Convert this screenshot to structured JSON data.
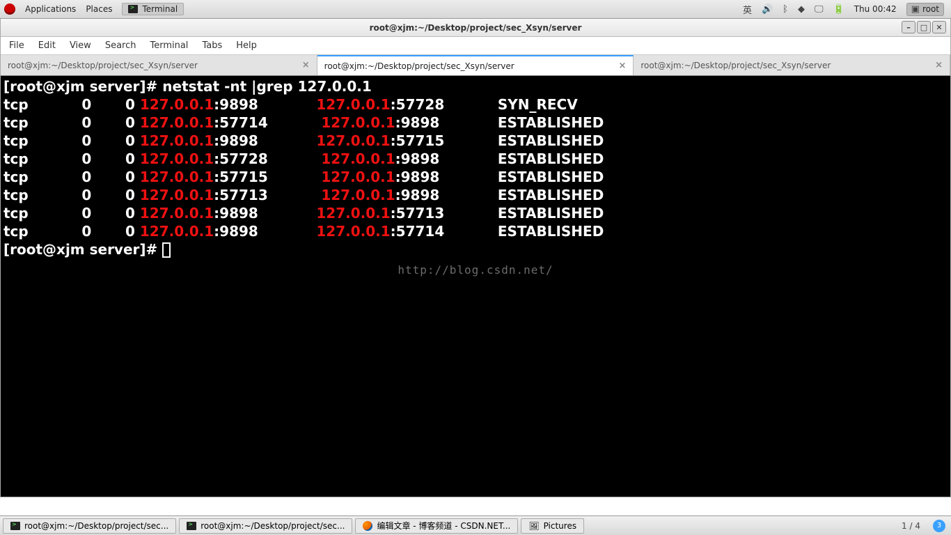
{
  "top_panel": {
    "applications": "Applications",
    "places": "Places",
    "running_app": "Terminal",
    "ime": "英",
    "clock": "Thu 00:42",
    "user": "root"
  },
  "window": {
    "title": "root@xjm:~/Desktop/project/sec_Xsyn/server",
    "menus": [
      "File",
      "Edit",
      "View",
      "Search",
      "Terminal",
      "Tabs",
      "Help"
    ],
    "tabs": [
      {
        "label": "root@xjm:~/Desktop/project/sec_Xsyn/server"
      },
      {
        "label": "root@xjm:~/Desktop/project/sec_Xsyn/server"
      },
      {
        "label": "root@xjm:~/Desktop/project/sec_Xsyn/server"
      }
    ]
  },
  "terminal": {
    "prompt": "[root@xjm server]# ",
    "command": "netstat -nt |grep 127.0.0.1",
    "rows": [
      {
        "proto": "tcp",
        "rq": "0",
        "sq": "0",
        "la_ip": "127.0.0.1",
        "la_port": "9898",
        "fa_ip": "127.0.0.1",
        "fa_port": "57728",
        "state": "SYN_RECV"
      },
      {
        "proto": "tcp",
        "rq": "0",
        "sq": "0",
        "la_ip": "127.0.0.1",
        "la_port": "57714",
        "fa_ip": "127.0.0.1",
        "fa_port": "9898",
        "state": "ESTABLISHED"
      },
      {
        "proto": "tcp",
        "rq": "0",
        "sq": "0",
        "la_ip": "127.0.0.1",
        "la_port": "9898",
        "fa_ip": "127.0.0.1",
        "fa_port": "57715",
        "state": "ESTABLISHED"
      },
      {
        "proto": "tcp",
        "rq": "0",
        "sq": "0",
        "la_ip": "127.0.0.1",
        "la_port": "57728",
        "fa_ip": "127.0.0.1",
        "fa_port": "9898",
        "state": "ESTABLISHED"
      },
      {
        "proto": "tcp",
        "rq": "0",
        "sq": "0",
        "la_ip": "127.0.0.1",
        "la_port": "57715",
        "fa_ip": "127.0.0.1",
        "fa_port": "9898",
        "state": "ESTABLISHED"
      },
      {
        "proto": "tcp",
        "rq": "0",
        "sq": "0",
        "la_ip": "127.0.0.1",
        "la_port": "57713",
        "fa_ip": "127.0.0.1",
        "fa_port": "9898",
        "state": "ESTABLISHED"
      },
      {
        "proto": "tcp",
        "rq": "0",
        "sq": "0",
        "la_ip": "127.0.0.1",
        "la_port": "9898",
        "fa_ip": "127.0.0.1",
        "fa_port": "57713",
        "state": "ESTABLISHED"
      },
      {
        "proto": "tcp",
        "rq": "0",
        "sq": "0",
        "la_ip": "127.0.0.1",
        "la_port": "9898",
        "fa_ip": "127.0.0.1",
        "fa_port": "57714",
        "state": "ESTABLISHED"
      }
    ],
    "prompt2": "[root@xjm server]# ",
    "watermark": "http://blog.csdn.net/"
  },
  "bottom_panel": {
    "tasks": [
      "root@xjm:~/Desktop/project/sec...",
      "root@xjm:~/Desktop/project/sec...",
      "编辑文章 - 博客频道 - CSDN.NET...",
      "Pictures"
    ],
    "workspace": "1 / 4",
    "badge": "3"
  }
}
